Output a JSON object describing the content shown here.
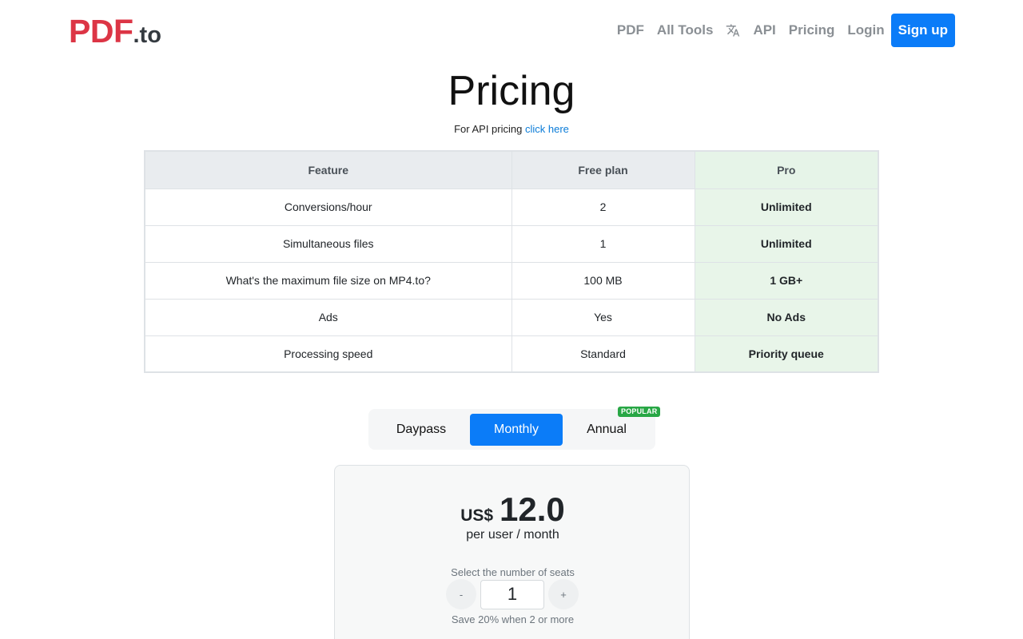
{
  "brand": {
    "name": "PDF",
    "suffix": ".to"
  },
  "nav": {
    "links": [
      "PDF",
      "All Tools",
      "API",
      "Pricing",
      "Login"
    ],
    "signup": "Sign up",
    "language_icon": "translate-icon"
  },
  "page": {
    "title": "Pricing",
    "api_note": "For API pricing",
    "api_link": "click here"
  },
  "table": {
    "headers": [
      "Feature",
      "Free plan",
      "Pro"
    ],
    "rows": [
      [
        "Conversions/hour",
        "2",
        "Unlimited"
      ],
      [
        "Simultaneous files",
        "1",
        "Unlimited"
      ],
      [
        "What's the maximum file size on MP4.to?",
        "100 MB",
        "1 GB+"
      ],
      [
        "Ads",
        "Yes",
        "No Ads"
      ],
      [
        "Processing speed",
        "Standard",
        "Priority queue"
      ]
    ]
  },
  "plans": {
    "options": [
      "Daypass",
      "Monthly",
      "Annual"
    ],
    "selected": "Monthly",
    "badge": "POPULAR"
  },
  "price": {
    "currency": "US$",
    "amount": "12.0",
    "period": "per user / month",
    "seats_label": "Select the number of seats",
    "decrement": "-",
    "increment": "+",
    "seats": "1",
    "save_note": "Save 20% when 2 or more"
  },
  "colors": {
    "brand": "#dc3545",
    "primary": "#0b7cf8",
    "pro_column": "#e8f5e9",
    "badge": "#28a745"
  }
}
